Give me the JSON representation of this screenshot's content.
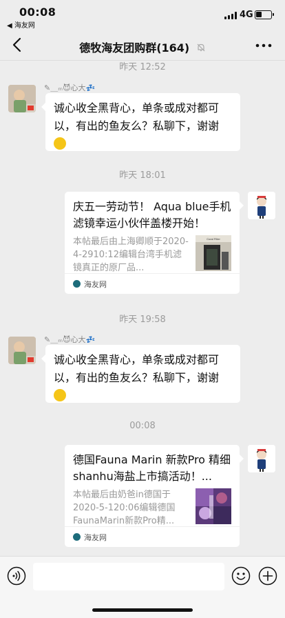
{
  "status_bar": {
    "time": "00:08",
    "back_app": "◀ 海友网",
    "network": "4G"
  },
  "nav": {
    "title": "德牧海友团购群(164)",
    "muted": true
  },
  "messages": [
    {
      "type": "time",
      "text": "昨天 12:52"
    },
    {
      "type": "text",
      "side": "left",
      "sender": "✎＿ₘ😈心大💤",
      "text": "诚心收全黑背心，单条或成对都可以，有出的鱼友么？私聊下，谢谢",
      "emoji": "grin-emoji"
    },
    {
      "type": "time",
      "text": "昨天 18:01"
    },
    {
      "type": "card",
      "side": "right",
      "title": "庆五一劳动节！ Aqua blue手机滤镜幸运小伙伴盖楼开始！",
      "desc": "本帖最后由上海卿顺于2020-4-2910:12编辑台湾手机滤镜真正的原厂品...",
      "source": "海友网",
      "thumb_label": "Coral Filter"
    },
    {
      "type": "time",
      "text": "昨天 19:58"
    },
    {
      "type": "text",
      "side": "left",
      "sender": "✎＿ₘ😈心大💤",
      "text": "诚心收全黑背心，单条或成对都可以，有出的鱼友么？私聊下，谢谢",
      "emoji": "grin-emoji"
    },
    {
      "type": "time",
      "text": "00:08"
    },
    {
      "type": "card",
      "side": "right",
      "title": "德国Fauna Marin 新款Pro 精细shanhu海盐上市搞活动！...",
      "desc": "本帖最后由奶爸in德国于2020-5-120:06编辑德国FaunaMarin新款Pro精...",
      "source": "海友网",
      "thumb_label": ""
    }
  ],
  "input": {
    "placeholder": "",
    "value": ""
  },
  "colors": {
    "chat_bg": "#ededed",
    "bubble_bg": "#ffffff",
    "timestamp": "#9b9b9b"
  },
  "icons": {
    "back": "chevron-left-icon",
    "more": "more-dots-icon",
    "voice": "voice-icon",
    "emoji": "emoji-icon",
    "plus": "plus-icon",
    "mute": "mute-bell-icon"
  }
}
